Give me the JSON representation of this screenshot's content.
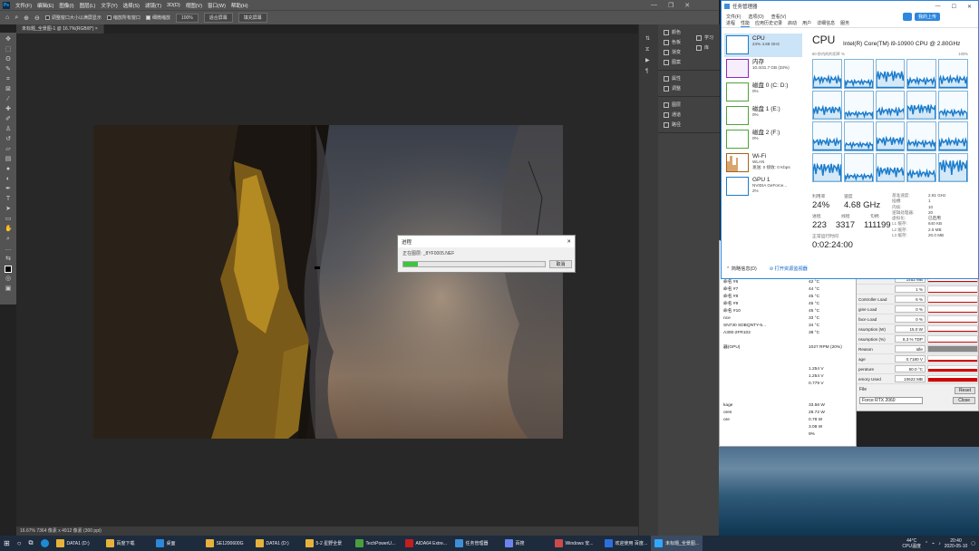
{
  "photoshop": {
    "menu": [
      "文件(F)",
      "编辑(E)",
      "图像(I)",
      "图层(L)",
      "文字(Y)",
      "选择(S)",
      "滤镜(T)",
      "3D(D)",
      "视图(V)",
      "窗口(W)",
      "帮助(H)"
    ],
    "options": {
      "fit_window": "调整窗口大小以满屏显示",
      "zoom_all": "缩放所有窗口",
      "scrubby_zoom": "细微缩放",
      "zoom_value": "100%",
      "fit_screen": "适合屏幕",
      "fill_screen": "填充屏幕"
    },
    "doc_tab": "未标题_全景图-1 @ 16.7%(RGB/8*) ×",
    "status": "16.67%    7364 像素 x 4912 像素 (300 ppi)",
    "panels": [
      [
        "颜色",
        "色板",
        "渐变",
        "图案"
      ],
      [
        "属性",
        "调整"
      ],
      [
        "图层",
        "通道",
        "路径"
      ]
    ],
    "learn": [
      "学习",
      "库"
    ]
  },
  "progress_dialog": {
    "title": "进程",
    "file": "正在图层: _8YF0005.NEF",
    "progress": 0.1,
    "cancel": "取消"
  },
  "aida": {
    "rows": [
      [
        "命名 #6",
        "42 °C"
      ],
      [
        "命名 #7",
        "44 °C"
      ],
      [
        "命名 #8",
        "45 °C"
      ],
      [
        "命名 #9",
        "45 °C"
      ],
      [
        "命名 #10",
        "45 °C"
      ],
      [
        "nce",
        "33 °C"
      ],
      [
        "SN730 SDBQNTY-5...",
        "34 °C"
      ],
      [
        "A300-2FR102",
        "38 °C"
      ],
      [
        "",
        ""
      ],
      [
        "器(GPU)",
        "1027 RPM  (20%)"
      ],
      [
        "",
        ""
      ],
      [
        "",
        ""
      ],
      [
        "",
        "1.254 V"
      ],
      [
        "",
        "1.254 V"
      ],
      [
        "",
        "0.779 V"
      ],
      [
        "",
        ""
      ],
      [
        "",
        ""
      ],
      [
        "kage",
        "33.56 W"
      ],
      [
        "ores",
        "28.72 W"
      ],
      [
        "ore",
        "0.78 W"
      ],
      [
        "",
        "3.08 W"
      ],
      [
        "",
        "9%"
      ]
    ]
  },
  "gpuz": {
    "rows": [
      {
        "label": "",
        "value": "1452 MB",
        "fill": 0.15
      },
      {
        "label": "",
        "value": "1 %",
        "fill": 0.05
      },
      {
        "label": "Controller Load",
        "value": "6 %",
        "fill": 0.06
      },
      {
        "label": "gine Load",
        "value": "0 %",
        "fill": 0
      },
      {
        "label": "face Load",
        "value": "0 %",
        "fill": 0
      },
      {
        "label": "nsumption (W)",
        "value": "15.0 W",
        "fill": 0.1
      },
      {
        "label": "nsumption (%)",
        "value": "8.3 % TDP",
        "fill": 0.08
      },
      {
        "label": "Reason",
        "value": "Idle",
        "fill": 1
      },
      {
        "label": "age",
        "value": "0.7180 V",
        "fill": 0.35
      },
      {
        "label": "perature",
        "value": "50.0 °C",
        "fill": 0.5
      },
      {
        "label": "emory Used",
        "value": "10622 MB",
        "fill": 0.7
      }
    ],
    "file": "File",
    "reset": "Reset",
    "gpu_name": "Force RTX 2060",
    "close": "Close"
  },
  "task_manager": {
    "title": "任务管理器",
    "menu": [
      "文件(F)",
      "选项(O)",
      "查看(V)"
    ],
    "tabs": [
      "进程",
      "性能",
      "应用历史记录",
      "启动",
      "用户",
      "详细信息",
      "服务"
    ],
    "login": "我的上传",
    "side": [
      {
        "name": "CPU",
        "sub": "24%  4.68 GHz",
        "color": "#1b7ccc"
      },
      {
        "name": "内存",
        "sub": "10.4/31.7 GB (33%)",
        "color": "#8b29c3"
      },
      {
        "name": "磁盘 0 (C: D:)",
        "sub": "0%",
        "color": "#4da33a"
      },
      {
        "name": "磁盘 1 (E:)",
        "sub": "0%",
        "color": "#4da33a"
      },
      {
        "name": "磁盘 2 (F:)",
        "sub": "0%",
        "color": "#4da33a"
      },
      {
        "name": "Wi-Fi",
        "sub": "WLAN\n发送: 0 接收: 0 Kbps",
        "color": "#a7621d"
      },
      {
        "name": "GPU 1",
        "sub": "NVIDIA GeForce...\n2%",
        "color": "#1b7ccc"
      }
    ],
    "heading": "CPU",
    "model": "Intel(R) Core(TM) i9-10900 CPU @ 2.80GHz",
    "graph_label": "60 秒内的利用率 %",
    "graph_max": "100%",
    "stats": {
      "util_label": "利用率",
      "speed_label": "速度",
      "util": "24%",
      "speed": "4.68 GHz",
      "proc_label": "进程",
      "thread_label": "线程",
      "handle_label": "句柄",
      "proc": "223",
      "thread": "3317",
      "handle": "111199",
      "uptime_label": "正常运行时间",
      "uptime": "0:02:24:00"
    },
    "specs": [
      [
        "基准速度:",
        "2.81 GHz"
      ],
      [
        "插槽:",
        "1"
      ],
      [
        "内核:",
        "10"
      ],
      [
        "逻辑处理器:",
        "20"
      ],
      [
        "虚拟化:",
        "已启用"
      ],
      [
        "L1 缓存:",
        "640 KB"
      ],
      [
        "L2 缓存:",
        "2.5 MB"
      ],
      [
        "L3 缓存:",
        "20.0 MB"
      ]
    ],
    "core_load": [
      0.3,
      0.2,
      0.45,
      0.25,
      0.3,
      0.35,
      0.2,
      0.3,
      0.4,
      0.25,
      0.3,
      0.2,
      0.35,
      0.25,
      0.3,
      0.5,
      0.2,
      0.4,
      0.3,
      0.6
    ],
    "less": "简略信息(D)",
    "open_rm": "打开资源监视器"
  },
  "taskbar": {
    "items": [
      {
        "label": "DATA1 (D:)",
        "color": "#e8b23a"
      },
      {
        "label": "百度下载",
        "color": "#e8b23a"
      },
      {
        "label": "桌面",
        "color": "#2c88d9"
      },
      {
        "label": "SE1200600G",
        "color": "#e8b23a"
      },
      {
        "label": "DATA1 (D:)",
        "color": "#e8b23a"
      },
      {
        "label": "5-2 星野全景",
        "color": "#e8b23a"
      },
      {
        "label": "TechPowerU...",
        "color": "#4a9f3d"
      },
      {
        "label": "AIDA64 Extre...",
        "color": "#c41e1e"
      },
      {
        "label": "任务管理器",
        "color": "#3f8fd6"
      },
      {
        "label": "百搜",
        "color": "#6c84f0"
      },
      {
        "label": "Windows 安...",
        "color": "#cc4a4a"
      },
      {
        "label": "欢迎使用 百度...",
        "color": "#2c6fe0"
      },
      {
        "label": "未标题_全景图...",
        "color": "#31a8ff"
      }
    ],
    "weather": "44°C\nCPU温度",
    "time": "20:40",
    "date": "2020-05-10"
  }
}
